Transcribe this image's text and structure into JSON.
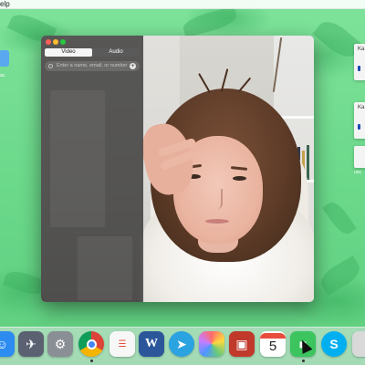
{
  "menubar": {
    "app_menu_label": "elp"
  },
  "desktop": {
    "left_item_label": "ac",
    "right_cards": [
      {
        "label": "Ka"
      },
      {
        "label": "Ka"
      }
    ],
    "right_item_label": "unc"
  },
  "video_window": {
    "tabs": [
      {
        "label": "Video"
      },
      {
        "label": "Audio"
      }
    ],
    "search_placeholder": "Enter a name, email, or number",
    "add_button_label": "+",
    "colors": {
      "close": "#ff5f57",
      "minimize": "#febc2e",
      "zoom": "#28c840"
    }
  },
  "dock": {
    "icons": [
      {
        "name": "finder-icon",
        "color": "#2d8cf0"
      },
      {
        "name": "launchpad-icon",
        "color": "#5b6170"
      },
      {
        "name": "system-preferences-icon",
        "color": "#8a8f96"
      },
      {
        "name": "chrome-icon",
        "color": "#ffffff"
      },
      {
        "name": "reminders-icon",
        "color": "#f7f7f7"
      },
      {
        "name": "word-icon",
        "color": "#2b579a"
      },
      {
        "name": "telegram-icon",
        "color": "#2aa3e0"
      },
      {
        "name": "photos-icon",
        "color": "#ffffff"
      },
      {
        "name": "toolbox-icon",
        "color": "#c0392b"
      },
      {
        "name": "calendar-icon",
        "color": "#ffffff",
        "label": "5"
      },
      {
        "name": "facetime-icon",
        "color": "#3cc45f"
      },
      {
        "name": "skype-icon",
        "color": "#00aff0"
      },
      {
        "name": "trash-icon",
        "color": "#d9d9d9"
      }
    ]
  }
}
